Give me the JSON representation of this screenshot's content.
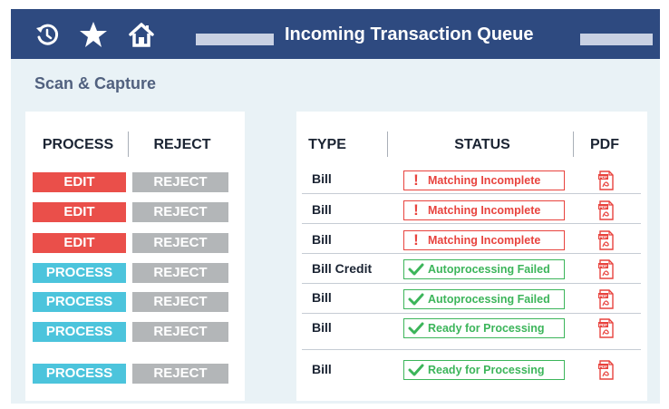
{
  "header": {
    "title": "Incoming Transaction Queue",
    "icons": [
      "history-icon",
      "star-icon",
      "home-icon"
    ],
    "colors": {
      "background": "#2e4a80",
      "text": "#ffffff",
      "accent_bar": "#c9d1e3"
    }
  },
  "section": {
    "title": "Scan & Capture"
  },
  "actions_table": {
    "headers": {
      "process": "PROCESS",
      "reject": "REJECT"
    },
    "rows": [
      {
        "action": "EDIT",
        "action_type": "edit",
        "reject": "REJECT"
      },
      {
        "action": "EDIT",
        "action_type": "edit",
        "reject": "REJECT"
      },
      {
        "action": "EDIT",
        "action_type": "edit",
        "reject": "REJECT"
      },
      {
        "action": "PROCESS",
        "action_type": "process",
        "reject": "REJECT"
      },
      {
        "action": "PROCESS",
        "action_type": "process",
        "reject": "REJECT"
      },
      {
        "action": "PROCESS",
        "action_type": "process",
        "reject": "REJECT"
      },
      {
        "action": "PROCESS",
        "action_type": "process",
        "reject": "REJECT"
      }
    ]
  },
  "transactions_table": {
    "headers": {
      "type": "TYPE",
      "status": "STATUS",
      "pdf": "PDF"
    },
    "rows": [
      {
        "type": "Bill",
        "status": "Matching Incomplete",
        "status_kind": "error"
      },
      {
        "type": "Bill",
        "status": "Matching Incomplete",
        "status_kind": "error"
      },
      {
        "type": "Bill",
        "status": "Matching Incomplete",
        "status_kind": "error"
      },
      {
        "type": "Bill Credit",
        "status": "Autoprocessing Failed",
        "status_kind": "success"
      },
      {
        "type": "Bill",
        "status": "Autoprocessing Failed",
        "status_kind": "success"
      },
      {
        "type": "Bill",
        "status": "Ready for Processing",
        "status_kind": "success"
      },
      {
        "type": "Bill",
        "status": "Ready for Processing",
        "status_kind": "success"
      }
    ],
    "pdf_icon": "pdf-file-icon",
    "pdf_badge": "PDF"
  },
  "colors": {
    "edit": "#ea4f4a",
    "process": "#4cc4dc",
    "reject": "#b3b6b8",
    "error": "#e8433e",
    "success": "#3cb55a",
    "panel_bg": "#e9f2f6"
  }
}
